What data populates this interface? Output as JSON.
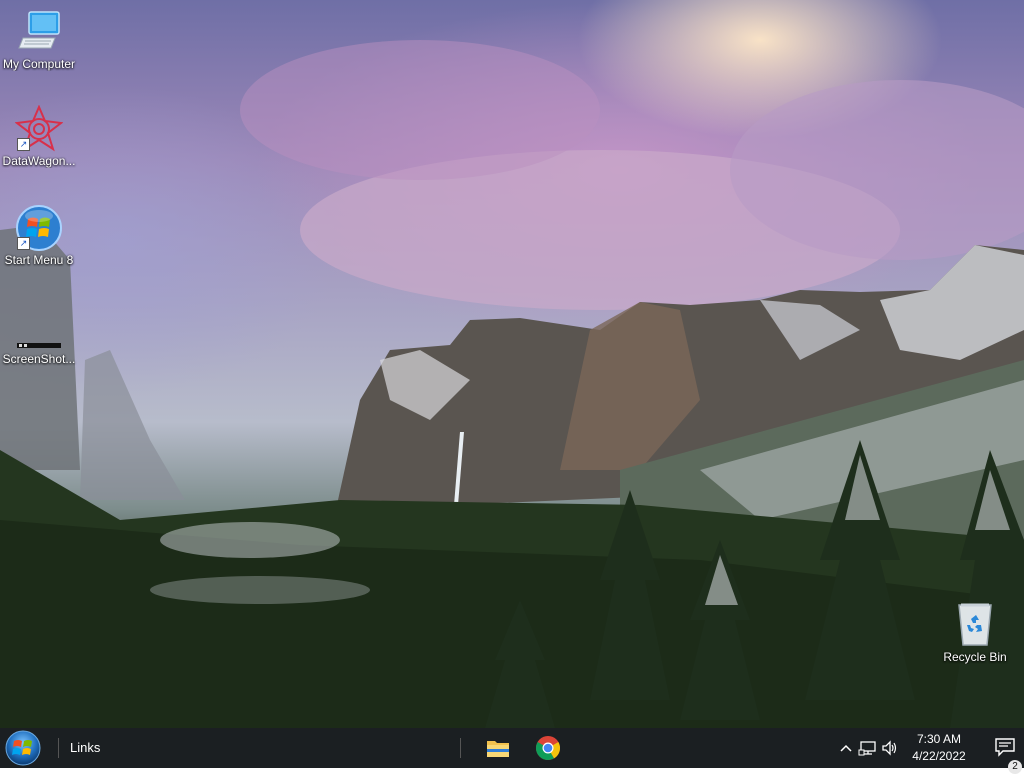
{
  "desktop": {
    "icons": [
      {
        "label": "My Computer",
        "icon": "computer-icon"
      },
      {
        "label": "DataWagon...",
        "icon": "datawagon-icon"
      },
      {
        "label": "Start Menu 8",
        "icon": "start-menu-8-icon"
      },
      {
        "label": "ScreenShot...",
        "icon": "screenshot-icon"
      },
      {
        "label": "Recycle Bin",
        "icon": "recycle-bin-icon"
      }
    ]
  },
  "taskbar": {
    "start_button": "windows-orb-icon",
    "links_label": "Links",
    "pinned_apps": [
      {
        "name": "File Explorer",
        "icon": "folder-icon"
      },
      {
        "name": "Google Chrome",
        "icon": "chrome-icon"
      }
    ],
    "tray": {
      "icons": [
        "chevron-up-icon",
        "network-icon",
        "volume-icon"
      ],
      "time": "7:30 AM",
      "date": "4/22/2022",
      "notification_count": "2"
    }
  },
  "colors": {
    "taskbar_bg": "#1b1f22",
    "accent_blue": "#1a8ad8"
  }
}
